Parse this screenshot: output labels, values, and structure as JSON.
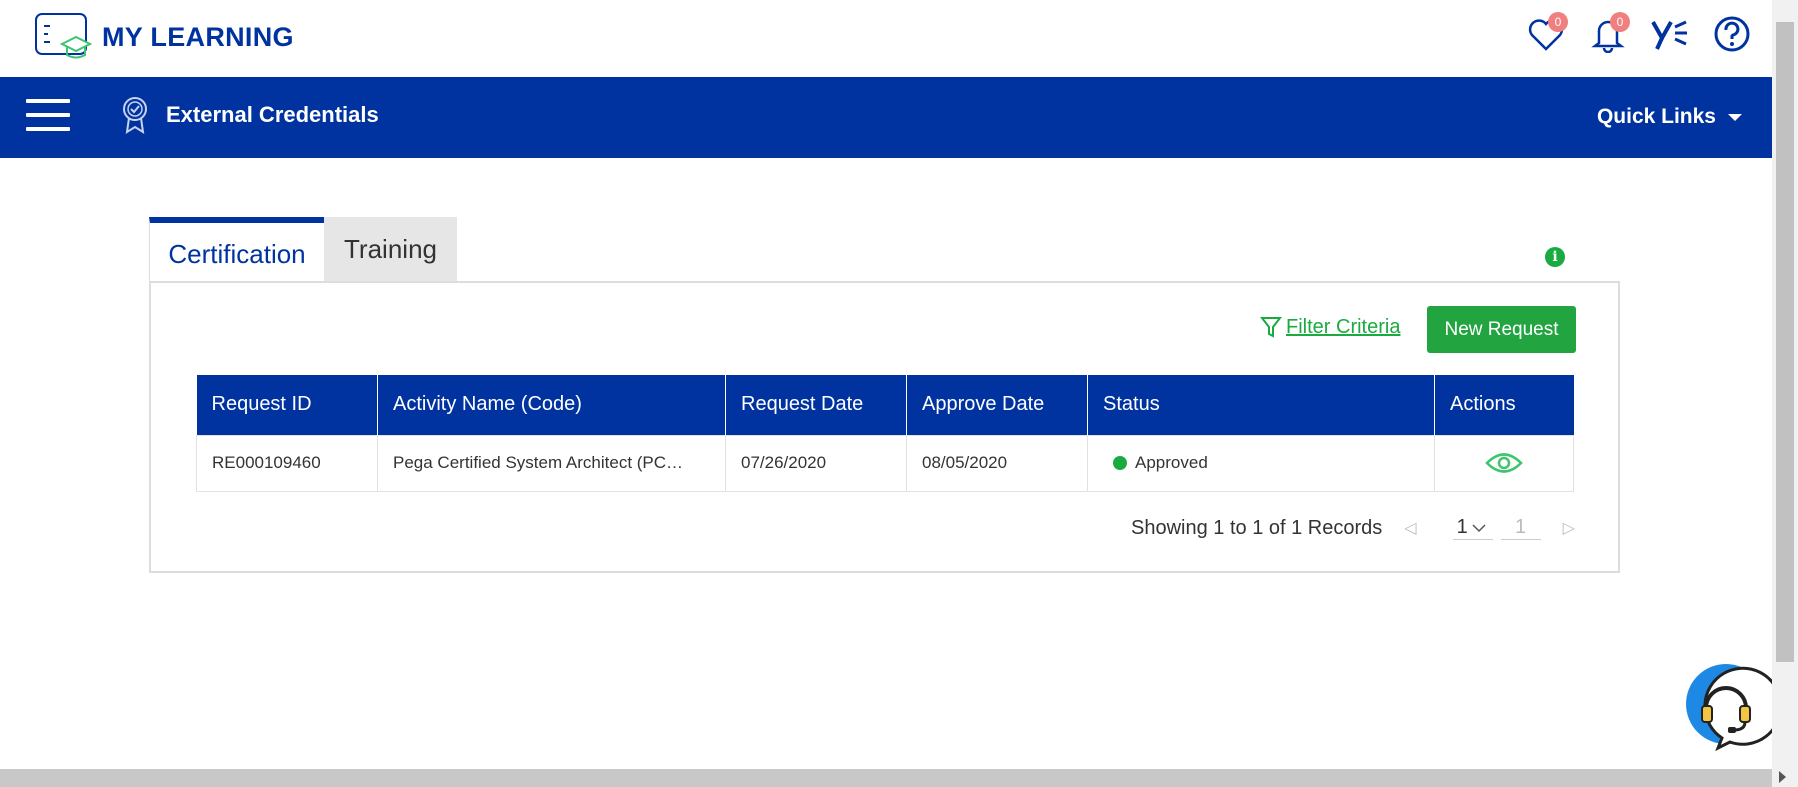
{
  "app": {
    "title": "MY LEARNING"
  },
  "header": {
    "favorites": {
      "icon": "heart-icon",
      "count": "0"
    },
    "notifications": {
      "icon": "bell-icon",
      "count": "0"
    },
    "brand_icon": "yammer-icon",
    "help_icon": "help-icon"
  },
  "nav": {
    "menu_icon": "hamburger-menu-icon",
    "page_icon": "certificate-badge-icon",
    "page_title": "External Credentials",
    "quick_links": "Quick Links"
  },
  "tabs": [
    {
      "label": "Certification",
      "active": true
    },
    {
      "label": "Training",
      "active": false
    }
  ],
  "toolbar": {
    "filter_label": "Filter Criteria",
    "new_request_label": "New Request"
  },
  "table": {
    "columns": [
      "Request ID",
      "Activity Name (Code)",
      "Request Date",
      "Approve Date",
      "Status",
      "Actions"
    ],
    "rows": [
      {
        "request_id": "RE000109460",
        "activity_name": "Pega Certified System Architect (PC…",
        "request_date": "07/26/2020",
        "approve_date": "08/05/2020",
        "status": "Approved",
        "action_icon": "eye-icon"
      }
    ]
  },
  "pagination": {
    "summary": "Showing 1 to 1 of 1 Records",
    "page_size": "1",
    "page": "1"
  },
  "colors": {
    "primary": "#0033a0",
    "success": "#22a441",
    "badge": "#f08080"
  }
}
